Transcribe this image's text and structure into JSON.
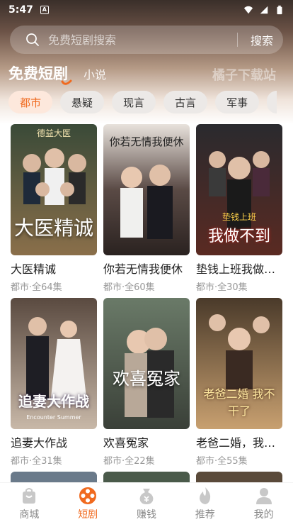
{
  "status": {
    "time": "5:47",
    "notif_glyph": "A"
  },
  "search": {
    "placeholder": "免费短剧搜索",
    "button": "搜索"
  },
  "top_tabs": [
    {
      "label": "免费短剧",
      "active": true
    },
    {
      "label": "小说",
      "active": false
    }
  ],
  "categories": [
    {
      "label": "都市",
      "active": true
    },
    {
      "label": "悬疑"
    },
    {
      "label": "现言"
    },
    {
      "label": "古言"
    },
    {
      "label": "军事"
    }
  ],
  "dramas": [
    {
      "title": "大医精诚",
      "meta": "都市·全64集",
      "poster_text": "大医精诚",
      "poster_top": "德益大医",
      "palette": [
        "#2b3a2e",
        "#8a6f4a"
      ]
    },
    {
      "title": "你若无情我便休",
      "meta": "都市·全60集",
      "poster_text": "你若无情我便休",
      "poster_top": "",
      "palette": [
        "#2a2a30",
        "#6a5a55"
      ]
    },
    {
      "title": "垫钱上班我做不到",
      "meta": "都市·全30集",
      "poster_text": "我做不到",
      "poster_top": "垫钱上班",
      "palette": [
        "#1e1a1a",
        "#7a2a20"
      ]
    },
    {
      "title": "追妻大作战",
      "meta": "都市·全31集",
      "poster_text": "追妻大作战",
      "poster_top": "Encounter Summer",
      "palette": [
        "#4a3a30",
        "#c8b8a8"
      ]
    },
    {
      "title": "欢喜冤家",
      "meta": "都市·全22集",
      "poster_text": "欢喜冤家",
      "poster_top": "",
      "palette": [
        "#3a4a3a",
        "#a8b0a0"
      ]
    },
    {
      "title": "老爸二婚，我不干了",
      "meta": "都市·全55集",
      "poster_text": "老爸二婚 我不干了",
      "poster_top": "",
      "palette": [
        "#3a2a20",
        "#c8a070"
      ]
    }
  ],
  "watermark": "橘子下载站",
  "bottom_nav": [
    {
      "label": "商城",
      "icon": "shop-bag-icon",
      "active": false
    },
    {
      "label": "短剧",
      "icon": "film-reel-icon",
      "active": true
    },
    {
      "label": "赚钱",
      "icon": "coin-bag-icon",
      "active": false
    },
    {
      "label": "推荐",
      "icon": "flame-icon",
      "active": false
    },
    {
      "label": "我的",
      "icon": "user-icon",
      "active": false
    }
  ],
  "colors": {
    "accent": "#f06a1f",
    "chip_active_bg": "#fde8dc",
    "chip_bg": "#ece9e7",
    "nav_inactive": "#c8c8c8"
  }
}
